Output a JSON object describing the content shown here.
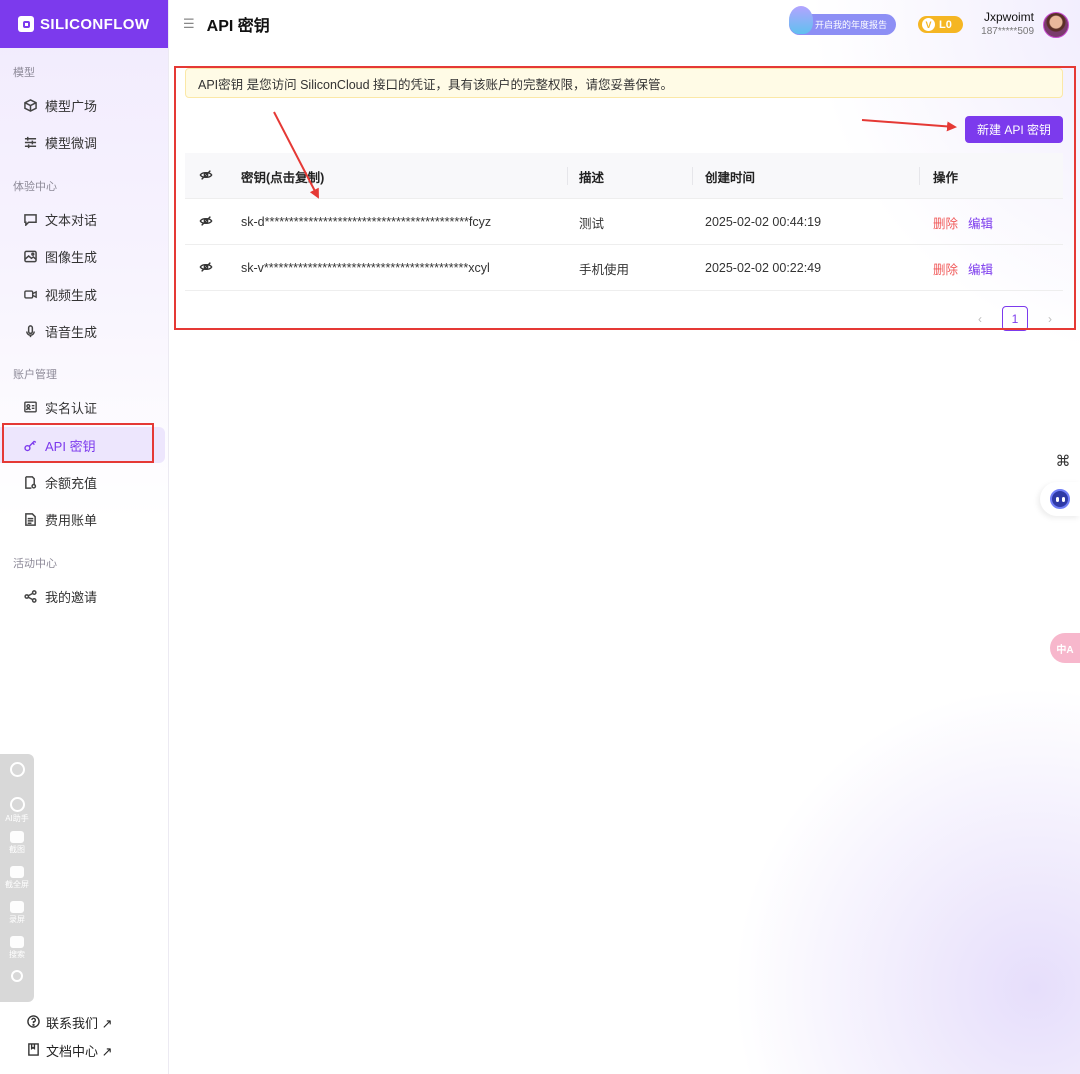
{
  "brand": {
    "name": "SILICONFLOW"
  },
  "sidebar": {
    "sections": [
      {
        "label": "模型",
        "items": [
          {
            "label": "模型广场",
            "icon": "cube-icon"
          },
          {
            "label": "模型微调",
            "icon": "sliders-icon"
          }
        ]
      },
      {
        "label": "体验中心",
        "items": [
          {
            "label": "文本对话",
            "icon": "chat-icon"
          },
          {
            "label": "图像生成",
            "icon": "image-icon"
          },
          {
            "label": "视频生成",
            "icon": "video-icon"
          },
          {
            "label": "语音生成",
            "icon": "microphone-icon"
          }
        ]
      },
      {
        "label": "账户管理",
        "items": [
          {
            "label": "实名认证",
            "icon": "id-card-icon"
          },
          {
            "label": "API 密钥",
            "icon": "key-icon",
            "active": true
          },
          {
            "label": "余额充值",
            "icon": "wallet-icon"
          },
          {
            "label": "费用账单",
            "icon": "bill-icon"
          }
        ]
      },
      {
        "label": "活动中心",
        "items": [
          {
            "label": "我的邀请",
            "icon": "share-icon"
          }
        ]
      }
    ],
    "footer": [
      {
        "label": "联系我们 ↗",
        "icon": "help-icon"
      },
      {
        "label": "文档中心 ↗",
        "icon": "doc-icon"
      }
    ],
    "float_tools": [
      "AI助手",
      "截图",
      "截全屏",
      "录屏",
      "搜索"
    ]
  },
  "header": {
    "title": "API 密钥",
    "report_label": "开启我的年度报告",
    "level": "L0",
    "level_prefix": "V",
    "user_name": "Jxpwoimt",
    "user_phone": "187*****509"
  },
  "notice": "API密钥 是您访问 SiliconCloud 接口的凭证，具有该账户的完整权限，请您妥善保管。",
  "new_key_button": "新建 API 密钥",
  "table": {
    "headers": {
      "key": "密钥(点击复制)",
      "desc": "描述",
      "created": "创建时间",
      "actions": "操作"
    },
    "rows": [
      {
        "key": "sk-d******************************************fcyz",
        "desc": "测试",
        "created": "2025-02-02 00:44:19",
        "delete": "删除",
        "edit": "编辑"
      },
      {
        "key": "sk-v******************************************xcyl",
        "desc": "手机使用",
        "created": "2025-02-02 00:22:49",
        "delete": "删除",
        "edit": "编辑"
      }
    ]
  },
  "pagination": {
    "current": "1",
    "prev": "‹",
    "next": "›"
  },
  "widgets": {
    "grid_glyph": "⌘",
    "translate_label": "中A"
  },
  "colors": {
    "brand": "#7c3aed",
    "danger": "#f05a5a",
    "annotation": "#e53935"
  }
}
